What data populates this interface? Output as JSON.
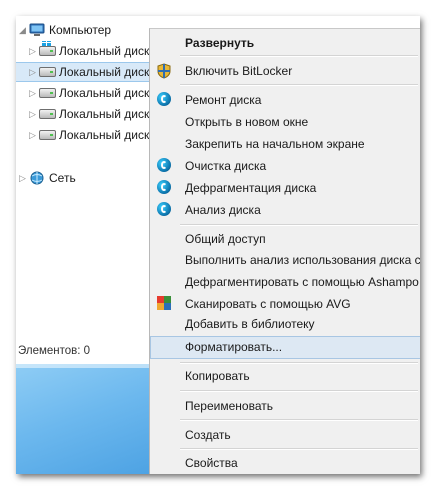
{
  "nav": {
    "computer_label": "Компьютер",
    "drives": [
      {
        "label": "Локальный диск"
      },
      {
        "label": "Локальный диск"
      },
      {
        "label": "Локальный диск"
      },
      {
        "label": "Локальный диск"
      },
      {
        "label": "Локальный диск"
      }
    ],
    "network_label": "Сеть",
    "status": "Элементов: 0"
  },
  "menu": {
    "items": [
      {
        "label": "Развернуть",
        "icon": "none",
        "bold": true
      },
      {
        "label": "Включить BitLocker",
        "icon": "bitlocker-shield-icon"
      },
      {
        "label": "Ремонт диска",
        "icon": "ccleaner-icon"
      },
      {
        "label": "Открыть в новом окне",
        "icon": "none"
      },
      {
        "label": "Закрепить на начальном экране",
        "icon": "none"
      },
      {
        "label": "Очистка диска",
        "icon": "ccleaner-icon"
      },
      {
        "label": "Дефрагментация диска",
        "icon": "ccleaner-icon"
      },
      {
        "label": "Анализ диска",
        "icon": "ccleaner-icon"
      },
      {
        "label": "Общий доступ",
        "icon": "none"
      },
      {
        "label": "Выполнить анализ использования диска с",
        "icon": "none"
      },
      {
        "label": "Дефрагментировать с помощью Ashampo",
        "icon": "none"
      },
      {
        "label": "Сканировать с помощью AVG",
        "icon": "avg-icon"
      },
      {
        "label": "Добавить в библиотеку",
        "icon": "none"
      },
      {
        "label": "Форматировать...",
        "icon": "none",
        "hovered": true
      },
      {
        "label": "Копировать",
        "icon": "none"
      },
      {
        "label": "Переименовать",
        "icon": "none"
      },
      {
        "label": "Создать",
        "icon": "none"
      },
      {
        "label": "Свойства",
        "icon": "none"
      }
    ]
  },
  "colors": {
    "selection": "#d8e9f8",
    "menu_bg": "#f0f0f0",
    "hover": "#dde8f3",
    "desktop": "#6cb8ee"
  }
}
